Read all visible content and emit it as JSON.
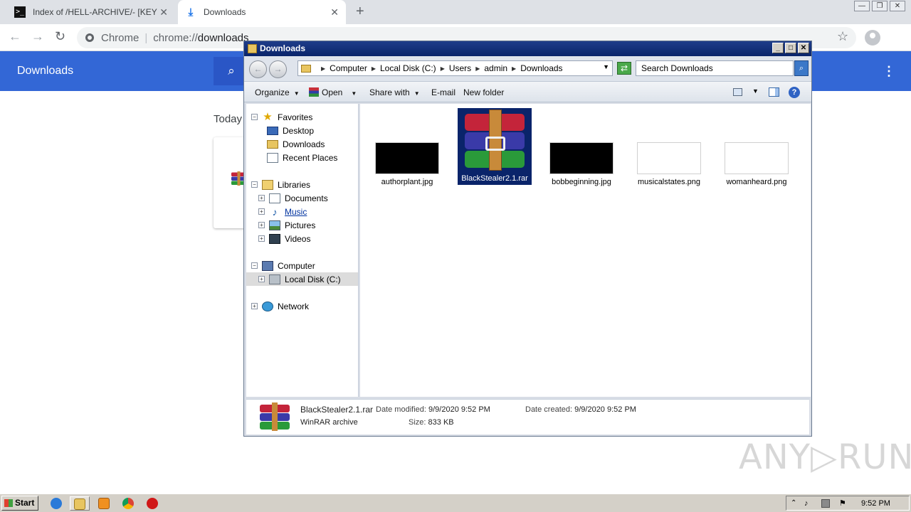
{
  "browser": {
    "tabs": [
      {
        "title": "Index of /HELL-ARCHIVE/- [KEYLOGGERS]",
        "icon": "terminal-icon"
      },
      {
        "title": "Downloads",
        "icon": "download-icon",
        "active": true
      }
    ],
    "tab_close": "✕",
    "new_tab": "+",
    "omnibox": {
      "label": "Chrome",
      "url_scheme": "chrome://",
      "url_path": "downloads"
    },
    "window_buttons": {
      "minimize": "—",
      "restore": "❐",
      "close": "✕"
    }
  },
  "downloads_page": {
    "title": "Downloads",
    "section": "Today",
    "accent": "#3367d6"
  },
  "explorer": {
    "title": "Downloads",
    "breadcrumb": [
      "Computer",
      "Local Disk (C:)",
      "Users",
      "admin",
      "Downloads"
    ],
    "search_placeholder": "Search Downloads",
    "commands": {
      "organize": "Organize",
      "open": "Open",
      "share_with": "Share with",
      "email": "E-mail",
      "new_folder": "New folder"
    },
    "nav": {
      "favorites": "Favorites",
      "desktop": "Desktop",
      "downloads": "Downloads",
      "recent_places": "Recent Places",
      "libraries": "Libraries",
      "documents": "Documents",
      "music": "Music",
      "pictures": "Pictures",
      "videos": "Videos",
      "computer": "Computer",
      "local_disk": "Local Disk (C:)",
      "network": "Network"
    },
    "files": [
      {
        "name": "authorplant.jpg",
        "thumb": "black"
      },
      {
        "name": "BlackStealer2.1.rar",
        "thumb": "winrar-icon",
        "selected": true
      },
      {
        "name": "bobbeginning.jpg",
        "thumb": "black"
      },
      {
        "name": "musicalstates.png",
        "thumb": "white"
      },
      {
        "name": "womanheard.png",
        "thumb": "white"
      }
    ],
    "details": {
      "filename": "BlackStealer2.1.rar",
      "type": "WinRAR archive",
      "modified_label": "Date modified:",
      "modified": "9/9/2020 9:52 PM",
      "created_label": "Date created:",
      "created": "9/9/2020 9:52 PM",
      "size_label": "Size:",
      "size": "833 KB"
    }
  },
  "watermark": "ANY▷RUN",
  "taskbar": {
    "start": "Start",
    "clock": "9:52 PM"
  }
}
